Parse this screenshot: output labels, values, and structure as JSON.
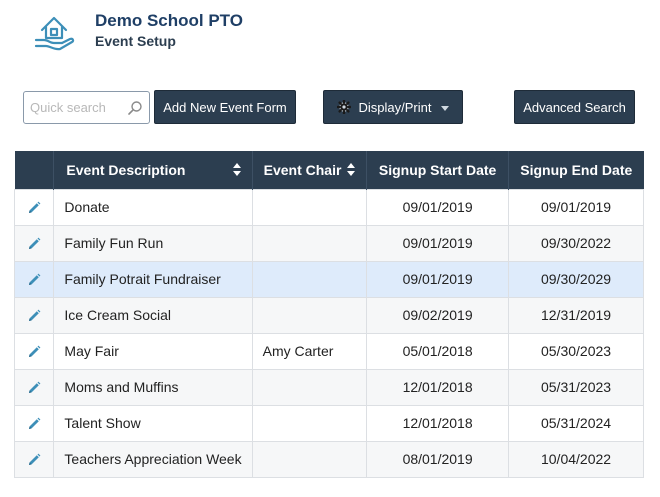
{
  "header": {
    "title": "Demo School PTO",
    "subtitle": "Event Setup",
    "logo_icon": "house-hand-icon"
  },
  "toolbar": {
    "search_placeholder": "Quick search",
    "search_value": "",
    "add_label": "Add New Event Form",
    "display_label": "Display/Print",
    "advanced_label": "Advanced Search"
  },
  "table": {
    "columns": {
      "description": "Event Description",
      "chair": "Event Chair",
      "start": "Signup Start Date",
      "end": "Signup End Date"
    },
    "rows": [
      {
        "description": "Donate",
        "chair": "",
        "start": "09/01/2019",
        "end": "09/01/2019"
      },
      {
        "description": "Family Fun Run",
        "chair": "",
        "start": "09/01/2019",
        "end": "09/30/2022"
      },
      {
        "description": "Family Potrait Fundraiser",
        "chair": "",
        "start": "09/01/2019",
        "end": "09/30/2029"
      },
      {
        "description": "Ice Cream Social",
        "chair": "",
        "start": "09/02/2019",
        "end": "12/31/2019"
      },
      {
        "description": "May Fair",
        "chair": "Amy Carter",
        "start": "05/01/2018",
        "end": "05/30/2023"
      },
      {
        "description": "Moms and Muffins",
        "chair": "",
        "start": "12/01/2018",
        "end": "05/31/2023"
      },
      {
        "description": "Talent Show",
        "chair": "",
        "start": "12/01/2018",
        "end": "05/31/2024"
      },
      {
        "description": "Teachers Appreciation Week",
        "chair": "",
        "start": "08/01/2019",
        "end": "10/04/2022"
      }
    ]
  },
  "colors": {
    "header_bg": "#2c3e50",
    "title": "#1f3f66",
    "selected_row": "#deebfb",
    "accent_icon": "#3d8fb8"
  }
}
